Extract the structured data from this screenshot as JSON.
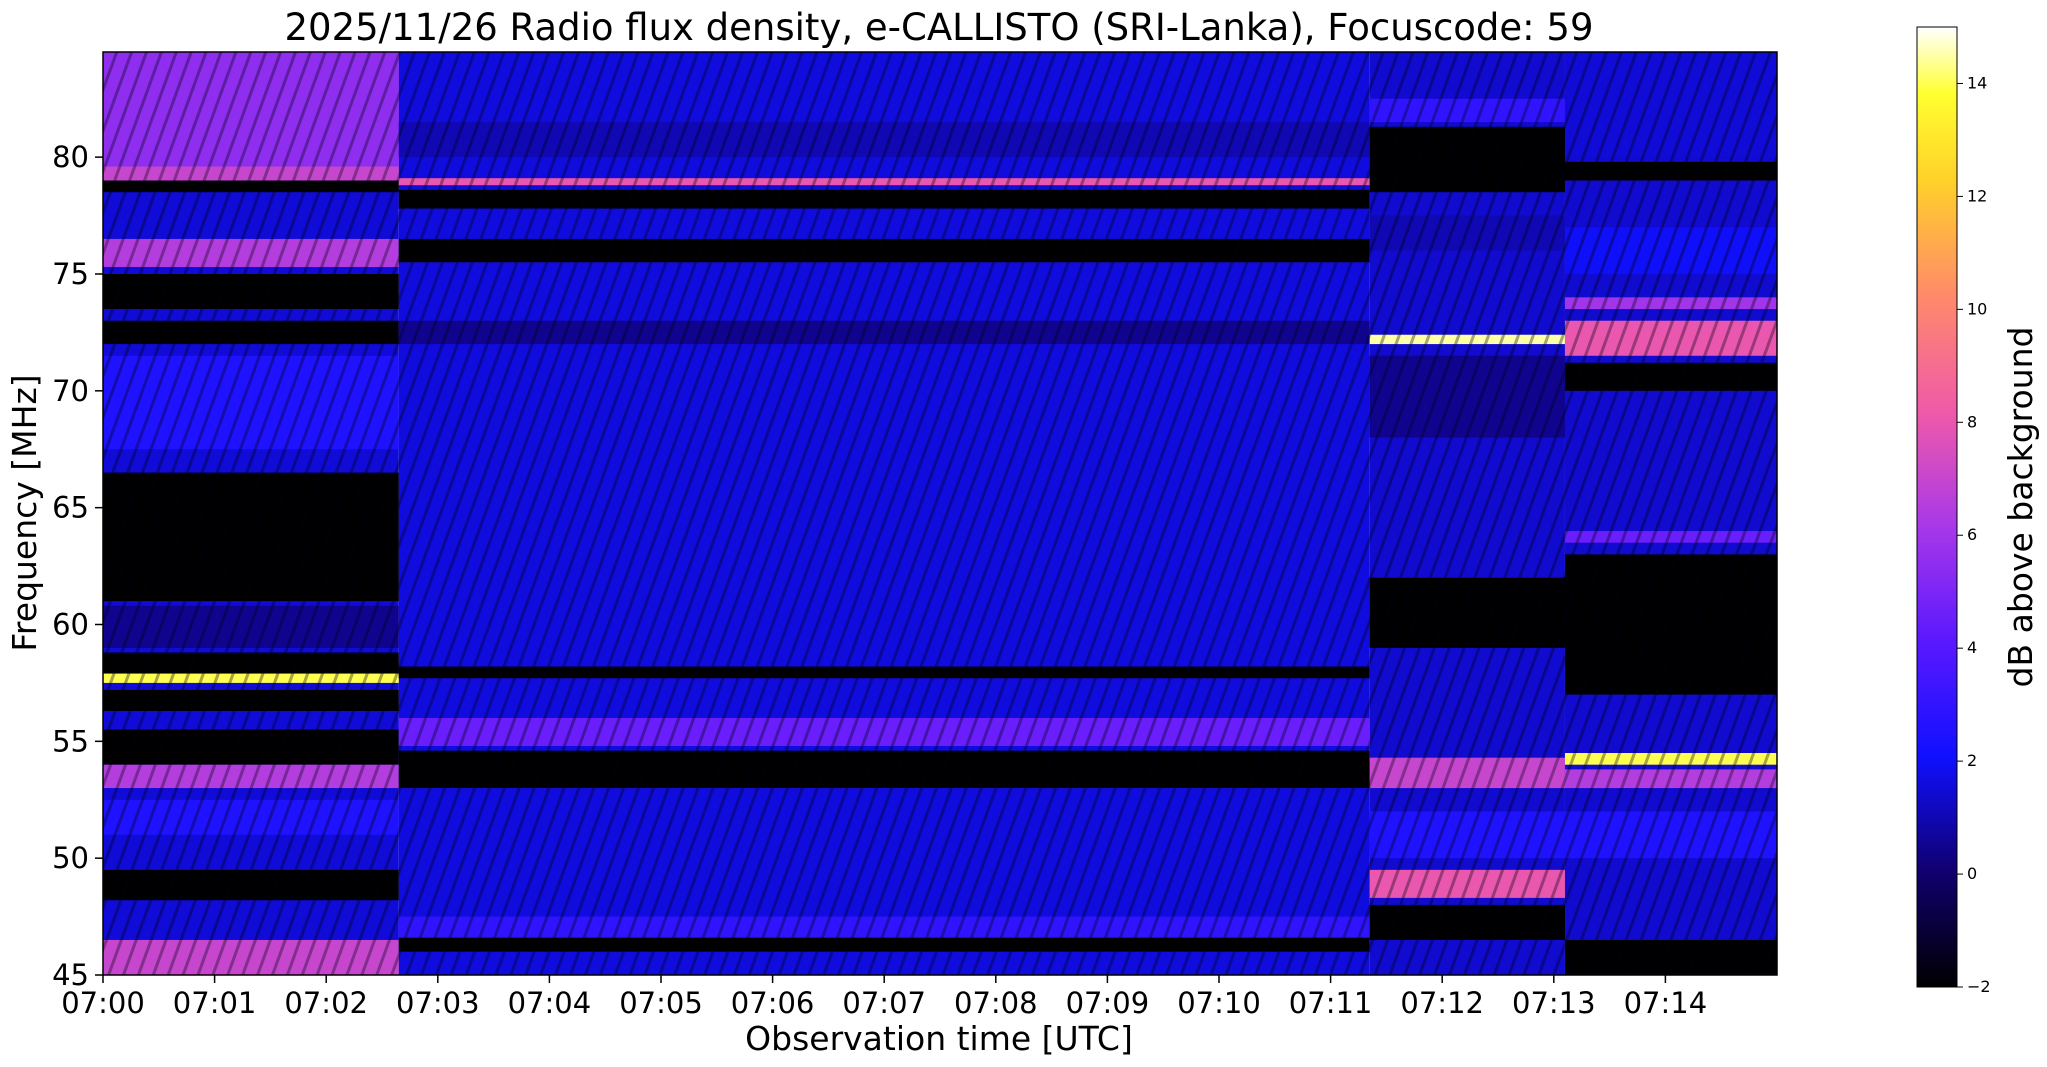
{
  "chart_data": {
    "type": "heatmap",
    "title": "2025/11/26  Radio flux density, e-CALLISTO (SRI-Lanka), Focuscode: 59",
    "xlabel": "Observation time [UTC]",
    "ylabel": "Frequency [MHz]",
    "x_range_minutes": [
      0,
      15
    ],
    "x_ticks": [
      {
        "label": "07:00",
        "value": 0
      },
      {
        "label": "07:01",
        "value": 1
      },
      {
        "label": "07:02",
        "value": 2
      },
      {
        "label": "07:03",
        "value": 3
      },
      {
        "label": "07:04",
        "value": 4
      },
      {
        "label": "07:05",
        "value": 5
      },
      {
        "label": "07:06",
        "value": 6
      },
      {
        "label": "07:07",
        "value": 7
      },
      {
        "label": "07:08",
        "value": 8
      },
      {
        "label": "07:09",
        "value": 9
      },
      {
        "label": "07:10",
        "value": 10
      },
      {
        "label": "07:11",
        "value": 11
      },
      {
        "label": "07:12",
        "value": 12
      },
      {
        "label": "07:13",
        "value": 13
      },
      {
        "label": "07:14",
        "value": 14
      }
    ],
    "ylim": [
      45,
      84.5
    ],
    "y_ticks": [
      {
        "label": "45",
        "value": 45
      },
      {
        "label": "50",
        "value": 50
      },
      {
        "label": "55",
        "value": 55
      },
      {
        "label": "60",
        "value": 60
      },
      {
        "label": "65",
        "value": 65
      },
      {
        "label": "70",
        "value": 70
      },
      {
        "label": "75",
        "value": 75
      },
      {
        "label": "80",
        "value": 80
      }
    ],
    "colorbar": {
      "label": "dB above background",
      "range": [
        -2,
        15
      ],
      "colormap": "gnuplot2",
      "ticks": [
        {
          "label": "−2",
          "value": -2
        },
        {
          "label": "0",
          "value": 0
        },
        {
          "label": "2",
          "value": 2
        },
        {
          "label": "4",
          "value": 4
        },
        {
          "label": "6",
          "value": 6
        },
        {
          "label": "8",
          "value": 8
        },
        {
          "label": "10",
          "value": 10
        },
        {
          "label": "12",
          "value": 12
        },
        {
          "label": "14",
          "value": 14
        }
      ]
    },
    "segments": [
      {
        "start": 0,
        "end": 2.65,
        "base": 1.5,
        "bands": [
          {
            "f0": 79.3,
            "f1": 84.5,
            "level": 5.5
          },
          {
            "f0": 79.0,
            "f1": 79.6,
            "level": 7.0
          },
          {
            "f0": 78.5,
            "f1": 79.0,
            "level": -2
          },
          {
            "f0": 75.3,
            "f1": 76.5,
            "level": 6.5
          },
          {
            "f0": 73.5,
            "f1": 75.0,
            "level": -2
          },
          {
            "f0": 72.0,
            "f1": 73.0,
            "level": -2
          },
          {
            "f0": 67.5,
            "f1": 71.5,
            "level": 2.5
          },
          {
            "f0": 61.0,
            "f1": 66.5,
            "level": -2
          },
          {
            "f0": 59.0,
            "f1": 60.8,
            "level": 0.5
          },
          {
            "f0": 57.9,
            "f1": 58.8,
            "level": -2
          },
          {
            "f0": 57.5,
            "f1": 57.9,
            "level": 14.0
          },
          {
            "f0": 56.3,
            "f1": 57.2,
            "level": -2
          },
          {
            "f0": 54.0,
            "f1": 55.5,
            "level": -2
          },
          {
            "f0": 53.0,
            "f1": 54.0,
            "level": 6.5
          },
          {
            "f0": 51.0,
            "f1": 52.5,
            "level": 2.5
          },
          {
            "f0": 48.2,
            "f1": 49.5,
            "level": -2
          },
          {
            "f0": 45.0,
            "f1": 46.5,
            "level": 7.0
          }
        ]
      },
      {
        "start": 2.65,
        "end": 11.35,
        "base": 1.6,
        "bands": [
          {
            "f0": 78.8,
            "f1": 79.1,
            "level": 8.0
          },
          {
            "f0": 80.0,
            "f1": 81.5,
            "level": 1.0
          },
          {
            "f0": 77.8,
            "f1": 78.6,
            "level": -2
          },
          {
            "f0": 75.5,
            "f1": 76.5,
            "level": -2
          },
          {
            "f0": 72.0,
            "f1": 73.0,
            "level": 0.5
          },
          {
            "f0": 57.7,
            "f1": 58.2,
            "level": -2
          },
          {
            "f0": 54.8,
            "f1": 56.0,
            "level": 4.5
          },
          {
            "f0": 53.0,
            "f1": 54.6,
            "level": -2
          },
          {
            "f0": 46.0,
            "f1": 46.6,
            "level": -2
          },
          {
            "f0": 46.6,
            "f1": 47.5,
            "level": 3.0
          }
        ]
      },
      {
        "start": 11.35,
        "end": 13.1,
        "base": 1.4,
        "bands": [
          {
            "f0": 81.5,
            "f1": 82.5,
            "level": 3.0
          },
          {
            "f0": 78.5,
            "f1": 81.3,
            "level": -2
          },
          {
            "f0": 76.0,
            "f1": 77.5,
            "level": 1.0
          },
          {
            "f0": 72.0,
            "f1": 72.4,
            "level": 14.5
          },
          {
            "f0": 68.0,
            "f1": 71.5,
            "level": 0.5
          },
          {
            "f0": 59.0,
            "f1": 62.0,
            "level": -2
          },
          {
            "f0": 53.0,
            "f1": 54.3,
            "level": 7.0
          },
          {
            "f0": 50.0,
            "f1": 52.0,
            "level": 2.5
          },
          {
            "f0": 48.3,
            "f1": 49.5,
            "level": 8.0
          },
          {
            "f0": 46.5,
            "f1": 48.0,
            "level": -2
          }
        ]
      },
      {
        "start": 13.1,
        "end": 15.0,
        "base": 1.4,
        "bands": [
          {
            "f0": 80.0,
            "f1": 84.5,
            "level": 1.5
          },
          {
            "f0": 79.0,
            "f1": 79.8,
            "level": -2
          },
          {
            "f0": 75.0,
            "f1": 77.0,
            "level": 2.0
          },
          {
            "f0": 73.5,
            "f1": 74.0,
            "level": 6.0
          },
          {
            "f0": 71.5,
            "f1": 73.0,
            "level": 8.0
          },
          {
            "f0": 70.0,
            "f1": 71.2,
            "level": -2
          },
          {
            "f0": 63.5,
            "f1": 64.0,
            "level": 4.5
          },
          {
            "f0": 57.0,
            "f1": 63.0,
            "level": -2
          },
          {
            "f0": 54.0,
            "f1": 54.5,
            "level": 14.0
          },
          {
            "f0": 53.0,
            "f1": 53.8,
            "level": 6.5
          },
          {
            "f0": 50.0,
            "f1": 52.0,
            "level": 2.5
          },
          {
            "f0": 45.0,
            "f1": 46.5,
            "level": -2
          }
        ]
      }
    ]
  }
}
